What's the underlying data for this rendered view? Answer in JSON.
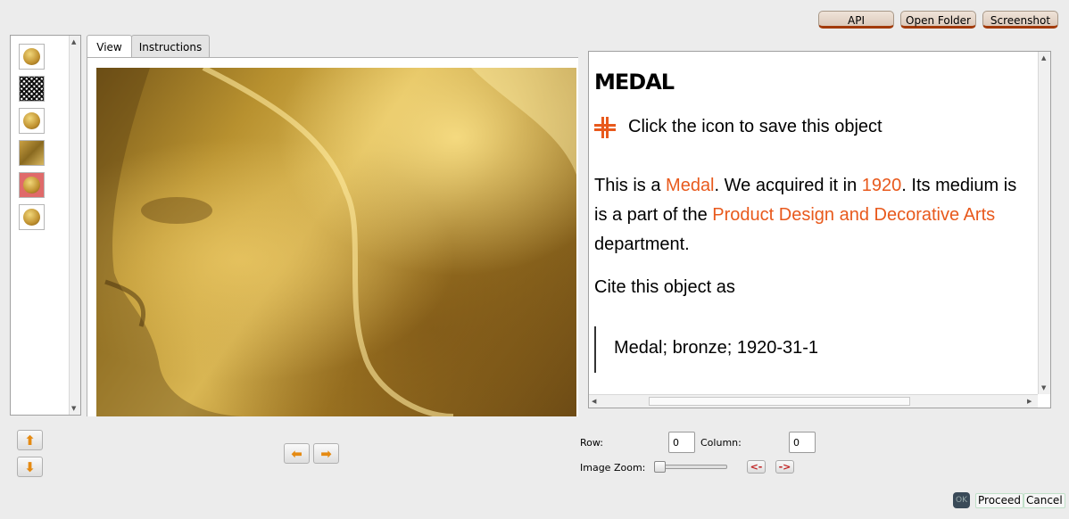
{
  "toolbar": {
    "api_label": "API",
    "open_folder_label": "Open Folder",
    "screenshot_label": "Screenshot"
  },
  "thumbnails": [
    {
      "kind": "coin"
    },
    {
      "kind": "noise"
    },
    {
      "kind": "coin"
    },
    {
      "kind": "portrait"
    },
    {
      "kind": "coin",
      "selected": true
    },
    {
      "kind": "coin"
    }
  ],
  "tabs": [
    {
      "label": "View",
      "active": true
    },
    {
      "label": "Instructions",
      "active": false
    }
  ],
  "object": {
    "title": "MEDAL",
    "save_text": "Click the icon to save this object",
    "para_1": "This is a ",
    "link_type": "Medal",
    "para_2": ". We acquired it in ",
    "link_year": "1920",
    "para_3": ". Its medium is",
    "para_line2_a": "is a part of the ",
    "link_dept": "Product Design and Decorative Arts",
    "para_line3": "department.",
    "cite_heading": "Cite this object as",
    "citation": "Medal; bronze; 1920-31-1"
  },
  "controls": {
    "row_label": "Row:",
    "row_value": "0",
    "column_label": "Column:",
    "column_value": "0",
    "zoom_label": "Image Zoom:",
    "zoom_in_label": "<-",
    "zoom_out_label": "->",
    "ok_label": "OK",
    "proceed_label": "Proceed",
    "cancel_label": "Cancel"
  },
  "colors": {
    "accent": "#e8591c",
    "button_border": "#a23a0a"
  }
}
